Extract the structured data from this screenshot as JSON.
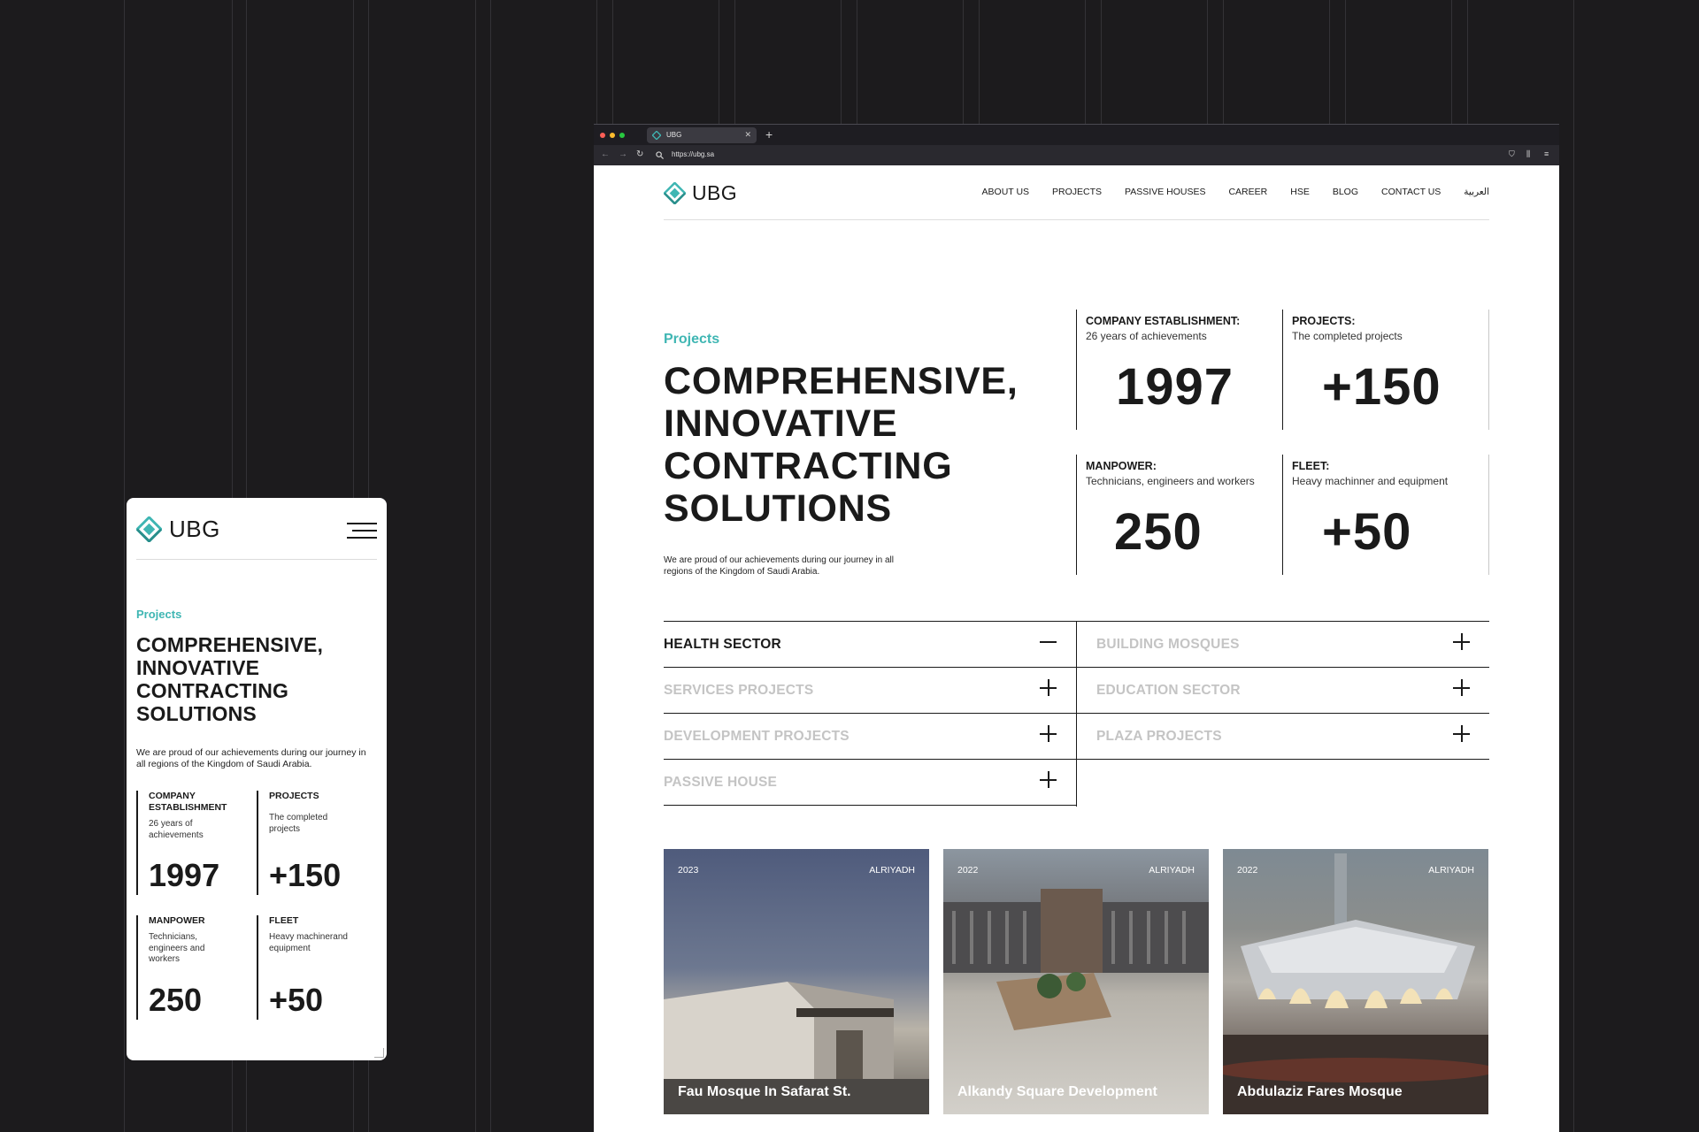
{
  "brand": {
    "name": "UBG",
    "accent": "#3fb6b3"
  },
  "mobile": {
    "kicker": "Projects",
    "title_lines": [
      "COMPREHENSIVE,",
      "INNOVATIVE",
      "CONTRACTING",
      "SOLUTIONS"
    ],
    "description": "We are proud of our achievements during our journey in all regions of the Kingdom of Saudi Arabia.",
    "stats": [
      {
        "label_lines": [
          "COMPANY",
          "ESTABLISHMENT"
        ],
        "sub_lines": [
          "26 years of",
          "achievements"
        ],
        "value": "1997"
      },
      {
        "label_lines": [
          "PROJECTS"
        ],
        "sub_lines": [
          "The completed",
          "projects"
        ],
        "value": "+150"
      },
      {
        "label_lines": [
          "MANPOWER"
        ],
        "sub_lines": [
          "Technicians,",
          "engineers and",
          "workers"
        ],
        "value": "250"
      },
      {
        "label_lines": [
          "FLEET"
        ],
        "sub_lines": [
          "Heavy machinerand",
          "equipment"
        ],
        "value": "+50"
      }
    ]
  },
  "browser": {
    "tab_title": "UBG",
    "url": "https://ubg.sa"
  },
  "desktop": {
    "nav": [
      "ABOUT US",
      "PROJECTS",
      "PASSIVE HOUSES",
      "CAREER",
      "HSE",
      "BLOG",
      "CONTACT US",
      "العربية"
    ],
    "kicker": "Projects",
    "title_lines": [
      "COMPREHENSIVE,",
      "INNOVATIVE",
      "CONTRACTING",
      "SOLUTIONS"
    ],
    "description_lines": [
      "We are proud of our achievements during our journey in all",
      "regions of the Kingdom of Saudi Arabia."
    ],
    "stats": [
      {
        "label": "COMPANY ESTABLISHMENT:",
        "sub": "26 years of achievements",
        "value": "1997"
      },
      {
        "label": "PROJECTS:",
        "sub": "The completed projects",
        "value": "+150"
      },
      {
        "label": "MANPOWER:",
        "sub": "Technicians, engineers and workers",
        "value": "250"
      },
      {
        "label": "FLEET:",
        "sub": "Heavy machinner and equipment",
        "value": "+50"
      }
    ],
    "sectors": [
      {
        "label": "HEALTH SECTOR",
        "expanded": true
      },
      {
        "label": "BUILDING MOSQUES",
        "expanded": false
      },
      {
        "label": "SERVICES PROJECTS",
        "expanded": false
      },
      {
        "label": "EDUCATION SECTOR",
        "expanded": false
      },
      {
        "label": "DEVELOPMENT PROJECTS",
        "expanded": false
      },
      {
        "label": "PLAZA PROJECTS",
        "expanded": false
      },
      {
        "label": "PASSIVE HOUSE",
        "expanded": false
      }
    ],
    "projects": [
      {
        "year": "2023",
        "city": "ALRIYADH",
        "name": "Fau Mosque In Safarat St."
      },
      {
        "year": "2022",
        "city": "ALRIYADH",
        "name": "Alkandy Square Development"
      },
      {
        "year": "2022",
        "city": "ALRIYADH",
        "name": "Abdulaziz Fares Mosque"
      }
    ]
  },
  "colors": {
    "background": "#1c1b1d",
    "text": "#1a1a1a",
    "muted": "#c4c4c4"
  }
}
